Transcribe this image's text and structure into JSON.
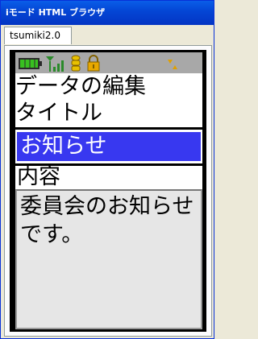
{
  "window": {
    "title": "iモード HTML ブラウザ"
  },
  "tabs": [
    {
      "label": "tsumiki2.0"
    }
  ],
  "status_icons": [
    "battery-icon",
    "signal-antenna-icon",
    "packet-icon",
    "lock-icon",
    "transfer-arrows-icon"
  ],
  "page": {
    "title": "データの編集",
    "field_label": "タイトル",
    "title_input": {
      "value": "お知らせ"
    },
    "content_label": "内容",
    "content_textarea": {
      "value": "委員会のお知らせです。"
    }
  },
  "colors": {
    "titlebar": "#0447d6",
    "focus_highlight": "#3838f0",
    "battery": "#38c020",
    "signal": "#2a8a2a",
    "lock": "#e8a800",
    "arrows": "#e0a000"
  }
}
